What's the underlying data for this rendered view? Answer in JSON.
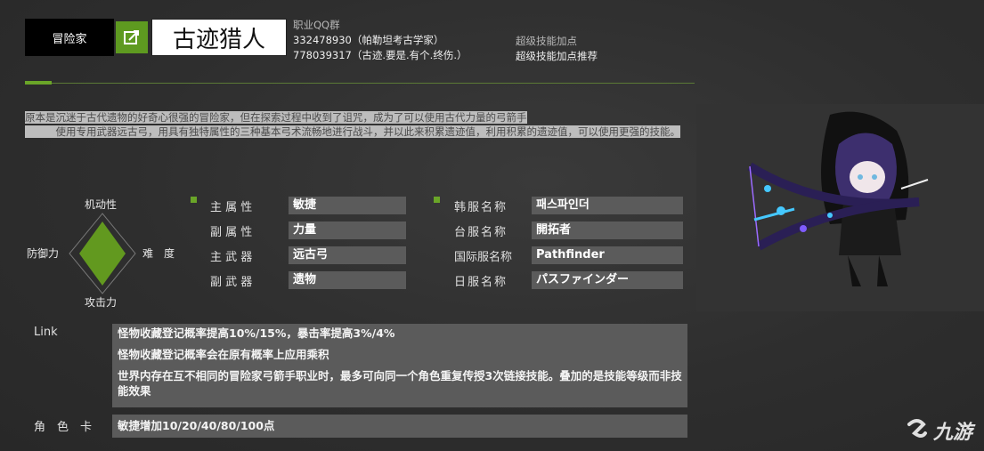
{
  "header": {
    "class_label": "冒险家",
    "job_name": "古迹猎人",
    "qq_label": "职业QQ群",
    "qq_groups": [
      "332478930（帕勒坦考古学家）",
      "778039317（古迹.要是.有个.终伤.）"
    ],
    "skill_label": "超级技能加点",
    "skill_link": "超级技能加点推荐"
  },
  "description": {
    "line1": "原本是沉迷于古代遗物的好奇心很强的冒险家，但在探索过程中收到了诅咒，成为了可以使用古代力量的弓箭手",
    "line2": "　　　使用专用武器远古弓，用具有独特属性的三种基本弓术流畅地进行战斗，并以此来积累遗迹值，利用积累的遗迹值，可以使用更强的技能。"
  },
  "stats_diamond": {
    "top": "机动性",
    "left": "防御力",
    "right": "难　度",
    "bottom": "攻击力",
    "accent": "#6aa528"
  },
  "attributes_left": [
    {
      "key": "主 属 性",
      "value": "敏捷"
    },
    {
      "key": "副 属 性",
      "value": "力量"
    },
    {
      "key": "主 武 器",
      "value": "远古弓"
    },
    {
      "key": "副 武 器",
      "value": "遗物"
    }
  ],
  "attributes_right": [
    {
      "key": "韩服名称",
      "value": "패스파인더"
    },
    {
      "key": "台服名称",
      "value": "開拓者"
    },
    {
      "key": "国际服名称",
      "value": "Pathfinder"
    },
    {
      "key": "日服名称",
      "value": "パスファインダー"
    }
  ],
  "link": {
    "label": "Link",
    "lines": [
      "怪物收藏登记概率提高10%/15%，暴击率提高3%/4%",
      "怪物收藏登记概率会在原有概率上应用乘积",
      "世界内存在互不相同的冒险家弓箭手职业时，最多可向同一个角色重复传授3次链接技能。叠加的是技能等级而非技能效果"
    ]
  },
  "card": {
    "label": "角　色　卡",
    "text": "敏捷增加10/20/40/80/100点"
  },
  "watermark": "九游",
  "colors": {
    "accent": "#6aa528",
    "panel": "#5b5b5b"
  }
}
